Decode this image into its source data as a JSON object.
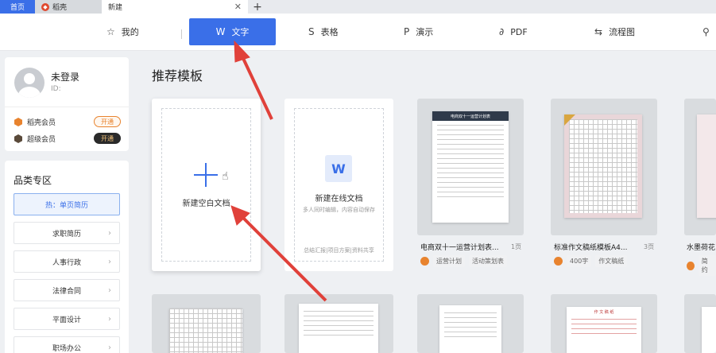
{
  "tabs": [
    {
      "label": "首页"
    },
    {
      "label": "稻壳"
    },
    {
      "label": "新建"
    }
  ],
  "toolbar": {
    "mine": "我的",
    "word": "文字",
    "sheet": "表格",
    "present": "演示",
    "pdf": "PDF",
    "flow": "流程图"
  },
  "user": {
    "name": "未登录",
    "id_label": "ID:",
    "docer_member": "稻壳会员",
    "super_member": "超级会员",
    "open": "开通"
  },
  "categories": {
    "title": "品类专区",
    "hot": "热：单页简历",
    "items": [
      "求职简历",
      "人事行政",
      "法律合同",
      "平面设计",
      "职场办公"
    ]
  },
  "main": {
    "section_title": "推荐模板",
    "blank_doc": "新建空白文档",
    "online_doc": "新建在线文档",
    "online_sub": "多人同时编辑，内容自动保存",
    "online_foot": "总结汇报|项目方案|资料共享"
  },
  "templates": [
    {
      "name": "电商双十一运营计划表...",
      "pages": "1页",
      "tags": [
        "运营计划",
        "活动策划表"
      ],
      "header": "电商双十一运营计划表"
    },
    {
      "name": "标准作文稿纸模板A4...",
      "pages": "3页",
      "tags": [
        "400字",
        "作文稿纸"
      ]
    },
    {
      "name": "水墨荷花",
      "pages": "",
      "tags": [
        "简约"
      ]
    }
  ],
  "bottom_row": {
    "essay_title": "作 文 稿 纸"
  },
  "colors": {
    "accent": "#3a6fe8",
    "arrow": "#e0413a",
    "orange": "#e8832e"
  }
}
